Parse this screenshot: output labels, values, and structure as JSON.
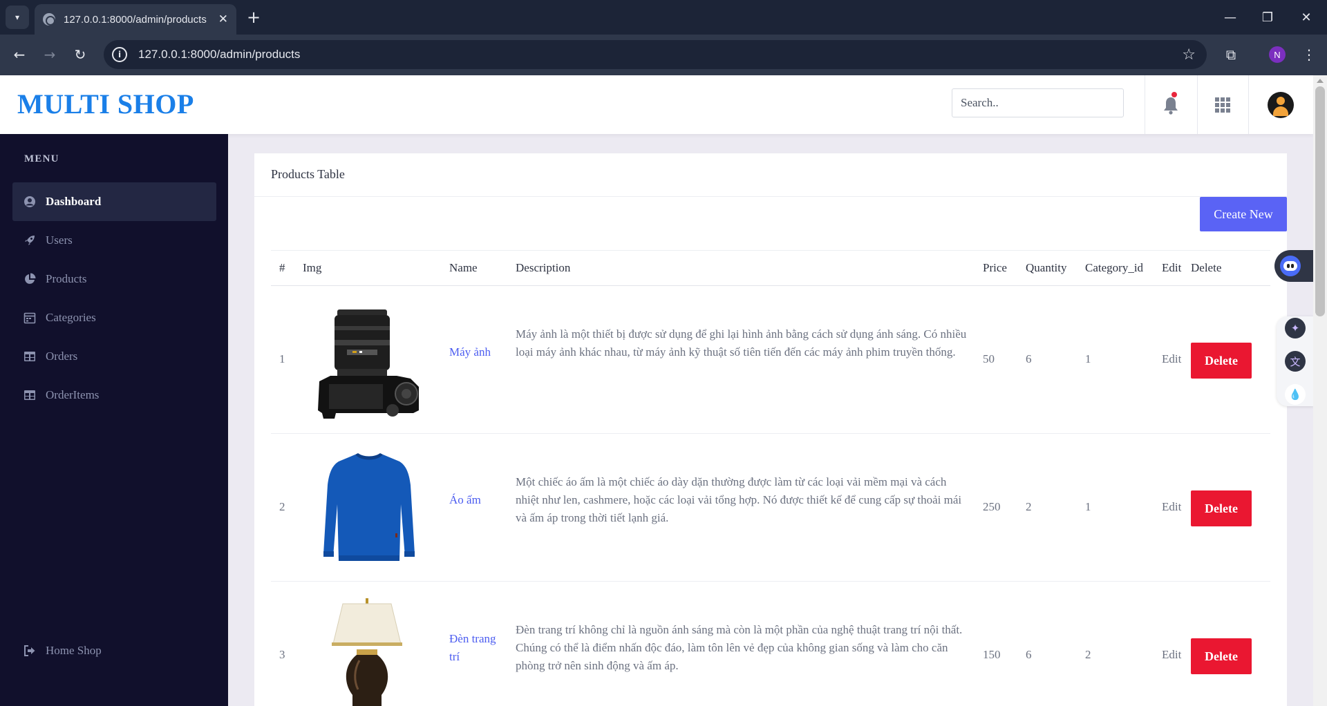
{
  "browser": {
    "tab_title": "127.0.0.1:8000/admin/products",
    "tab_close": "✕",
    "new_tab": "+",
    "url": "127.0.0.1:8000/admin/products",
    "profile_initial": "N",
    "window_controls": {
      "minimize": "—",
      "restore": "❐",
      "close": "✕"
    },
    "icons": [
      "tab-dropdown-icon",
      "globe-icon",
      "back-icon",
      "forward-icon",
      "reload-icon",
      "site-info-icon",
      "bookmark-star-icon",
      "extensions-icon",
      "more-icon"
    ]
  },
  "header": {
    "logo": "MULTI SHOP",
    "search_placeholder": "Search..",
    "icons": [
      "bell-icon",
      "apps-grid-icon",
      "avatar"
    ],
    "colors": {
      "logo": "#1a7fe8",
      "notification_dot": "#e8263c"
    }
  },
  "sidebar": {
    "menu_title": "MENU",
    "items": [
      {
        "label": "Dashboard",
        "icon": "user-circle-icon",
        "active": true
      },
      {
        "label": "Users",
        "icon": "rocket-icon",
        "active": false
      },
      {
        "label": "Products",
        "icon": "pie-chart-icon",
        "active": false
      },
      {
        "label": "Categories",
        "icon": "calendar-icon",
        "active": false
      },
      {
        "label": "Orders",
        "icon": "table-icon",
        "active": false
      },
      {
        "label": "OrderItems",
        "icon": "table-icon",
        "active": false
      }
    ],
    "footer_item": {
      "label": "Home Shop",
      "icon": "sign-out-icon"
    },
    "colors": {
      "background": "#11102c",
      "active_bg": "#232743",
      "text": "#8d93b0"
    }
  },
  "main": {
    "card_title": "Products Table",
    "create_button": "Create New",
    "columns": [
      "#",
      "Img",
      "Name",
      "Description",
      "Price",
      "Quantity",
      "Category_id",
      "Edit",
      "Delete"
    ],
    "rows": [
      {
        "id": "1",
        "image": "camera-image",
        "name": "Máy ảnh",
        "description": "Máy ảnh là một thiết bị được sử dụng để ghi lại hình ảnh bằng cách sử dụng ánh sáng. Có nhiều loại máy ảnh khác nhau, từ máy ảnh kỹ thuật số tiên tiến đến các máy ảnh phim truyền thống.",
        "price": "50",
        "quantity": "6",
        "category_id": "1",
        "edit": "Edit",
        "delete": "Delete"
      },
      {
        "id": "2",
        "image": "sweater-image",
        "name": "Áo ấm",
        "description": "Một chiếc áo ấm là một chiếc áo dày dặn thường được làm từ các loại vải mềm mại và cách nhiệt như len, cashmere, hoặc các loại vải tổng hợp. Nó được thiết kế để cung cấp sự thoải mái và ấm áp trong thời tiết lạnh giá.",
        "price": "250",
        "quantity": "2",
        "category_id": "1",
        "edit": "Edit",
        "delete": "Delete"
      },
      {
        "id": "3",
        "image": "lamp-image",
        "name": "Đèn trang trí",
        "description": "Đèn trang trí không chỉ là nguồn ánh sáng mà còn là một phần của nghệ thuật trang trí nội thất. Chúng có thể là điểm nhấn độc đáo, làm tôn lên vẻ đẹp của không gian sống và làm cho căn phòng trở nên sinh động và ấm áp.",
        "price": "150",
        "quantity": "6",
        "category_id": "2",
        "edit": "Edit",
        "delete": "Delete"
      }
    ],
    "colors": {
      "create_button": "#5a63f5",
      "delete_button": "#ea1731",
      "name_link": "#4b5cf0"
    }
  },
  "extensions": {
    "icons": [
      "robot-assistant-icon",
      "sparkle-icon",
      "translate-icon",
      "water-drop-icon"
    ]
  }
}
